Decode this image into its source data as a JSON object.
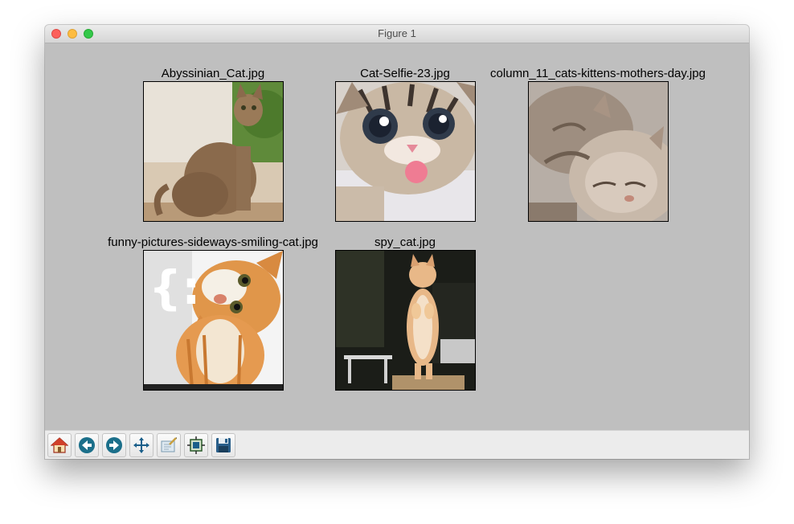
{
  "window": {
    "title": "Figure 1"
  },
  "figure": {
    "images": [
      {
        "label": "Abyssinian_Cat.jpg"
      },
      {
        "label": "Cat-Selfie-23.jpg"
      },
      {
        "label": "column_11_cats-kittens-mothers-day.jpg"
      },
      {
        "label": "funny-pictures-sideways-smiling-cat.jpg",
        "overlay_text": "{:"
      },
      {
        "label": "spy_cat.jpg"
      }
    ]
  },
  "toolbar": {
    "buttons": [
      {
        "icon": "home-icon"
      },
      {
        "icon": "back-arrow-icon"
      },
      {
        "icon": "forward-arrow-icon"
      },
      {
        "icon": "pan-move-icon"
      },
      {
        "icon": "zoom-rect-icon"
      },
      {
        "icon": "subplots-config-icon"
      },
      {
        "icon": "save-floppy-icon"
      }
    ]
  },
  "colors": {
    "canvas_bg": "#bfbfbf",
    "toolbar_bg": "#ececec"
  }
}
